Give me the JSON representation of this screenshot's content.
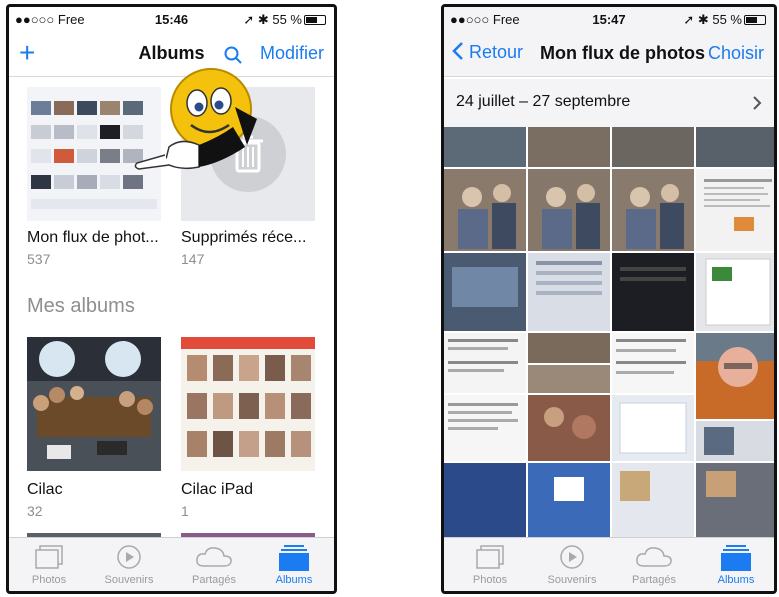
{
  "left": {
    "status": {
      "carrier": "●●○○○ Free",
      "time": "15:46",
      "battery": "55 %"
    },
    "nav": {
      "title": "Albums",
      "edit": "Modifier"
    },
    "albums_top": [
      {
        "name": "Mon flux de phot...",
        "count": "537"
      },
      {
        "name": "Supprimés réce...",
        "count": "147"
      }
    ],
    "section_title": "Mes albums",
    "albums_mine": [
      {
        "name": "Cilac",
        "count": "32"
      },
      {
        "name": "Cilac iPad",
        "count": "1"
      }
    ],
    "tabs": [
      {
        "label": "Photos"
      },
      {
        "label": "Souvenirs"
      },
      {
        "label": "Partagés"
      },
      {
        "label": "Albums"
      }
    ]
  },
  "right": {
    "status": {
      "carrier": "●●○○○ Free",
      "time": "15:47",
      "battery": "55 %"
    },
    "nav": {
      "back": "Retour",
      "title": "Mon flux de photos",
      "choose": "Choisir"
    },
    "date_range": "24 juillet – 27 septembre",
    "tabs": [
      {
        "label": "Photos"
      },
      {
        "label": "Souvenirs"
      },
      {
        "label": "Partagés"
      },
      {
        "label": "Albums"
      }
    ]
  },
  "colors": {
    "accent": "#1a7cf0",
    "gray_text": "#8e8e93"
  },
  "icons": [
    "add-icon",
    "search-icon",
    "trash-icon",
    "back-chevron-icon",
    "chevron-right-icon",
    "smiley-pointer-icon"
  ]
}
